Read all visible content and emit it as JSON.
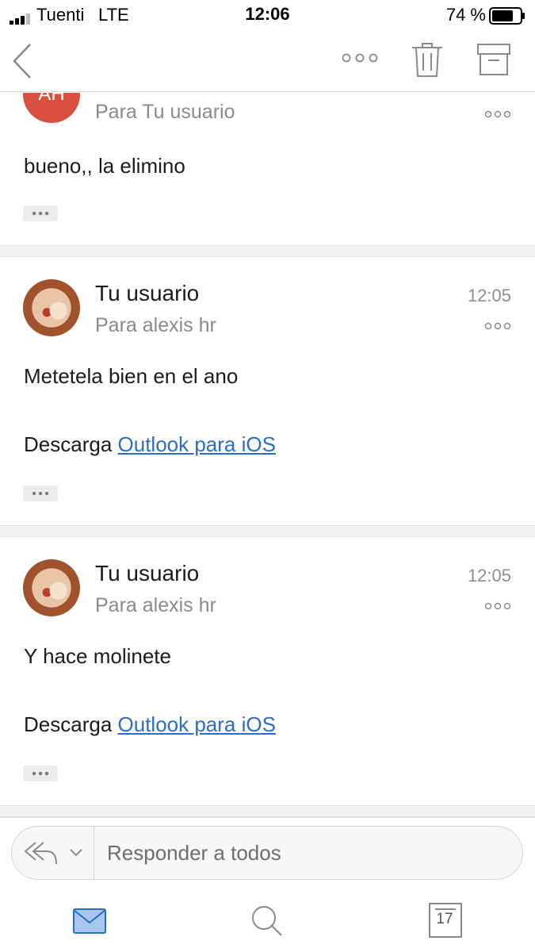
{
  "status_bar": {
    "carrier": "Tuenti",
    "network": "LTE",
    "time": "12:06",
    "battery_percent": "74 %"
  },
  "nav": {
    "back_icon": "chevron-left-icon",
    "more_icon": "ellipsis-icon",
    "trash_icon": "trash-icon",
    "archive_icon": "archive-icon"
  },
  "messages": [
    {
      "avatar_initials": "AH",
      "avatar_color": "#d9503f",
      "recipient": "Para Tu usuario",
      "body": "bueno,, la elimino"
    },
    {
      "sender": "Tu usuario",
      "recipient": "Para alexis hr",
      "time": "12:05",
      "body": "Metetela bien en el ano",
      "signature_prefix": "Descarga",
      "signature_link": "Outlook para iOS"
    },
    {
      "sender": "Tu usuario",
      "recipient": "Para alexis hr",
      "time": "12:05",
      "body": "Y hace molinete",
      "signature_prefix": "Descarga",
      "signature_link": "Outlook para iOS"
    }
  ],
  "reply": {
    "placeholder": "Responder a todos"
  },
  "tab_bar": {
    "calendar_day": "17",
    "active_color": "#2b6cc4"
  }
}
